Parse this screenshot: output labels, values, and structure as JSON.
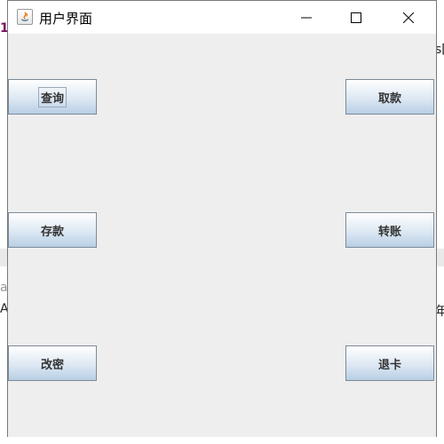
{
  "window": {
    "title": "用户界面",
    "icon": "java-icon"
  },
  "titlebar_buttons": {
    "minimize": "minimize-icon",
    "maximize": "maximize-icon",
    "close": "close-icon"
  },
  "buttons": {
    "query": "查询",
    "withdraw": "取款",
    "deposit": "存款",
    "transfer": "转账",
    "change_password": "改密",
    "eject_card": "退卡"
  },
  "background_fragments": {
    "top_left": "1",
    "left_mid1": "as",
    "left_mid2": "Ap",
    "right_top": "s[",
    "right_mid": "年"
  },
  "colors": {
    "window_bg": "#eeeeee",
    "button_top": "#ffffff",
    "button_bottom": "#b8cfe5",
    "button_border": "#7a8a99"
  }
}
